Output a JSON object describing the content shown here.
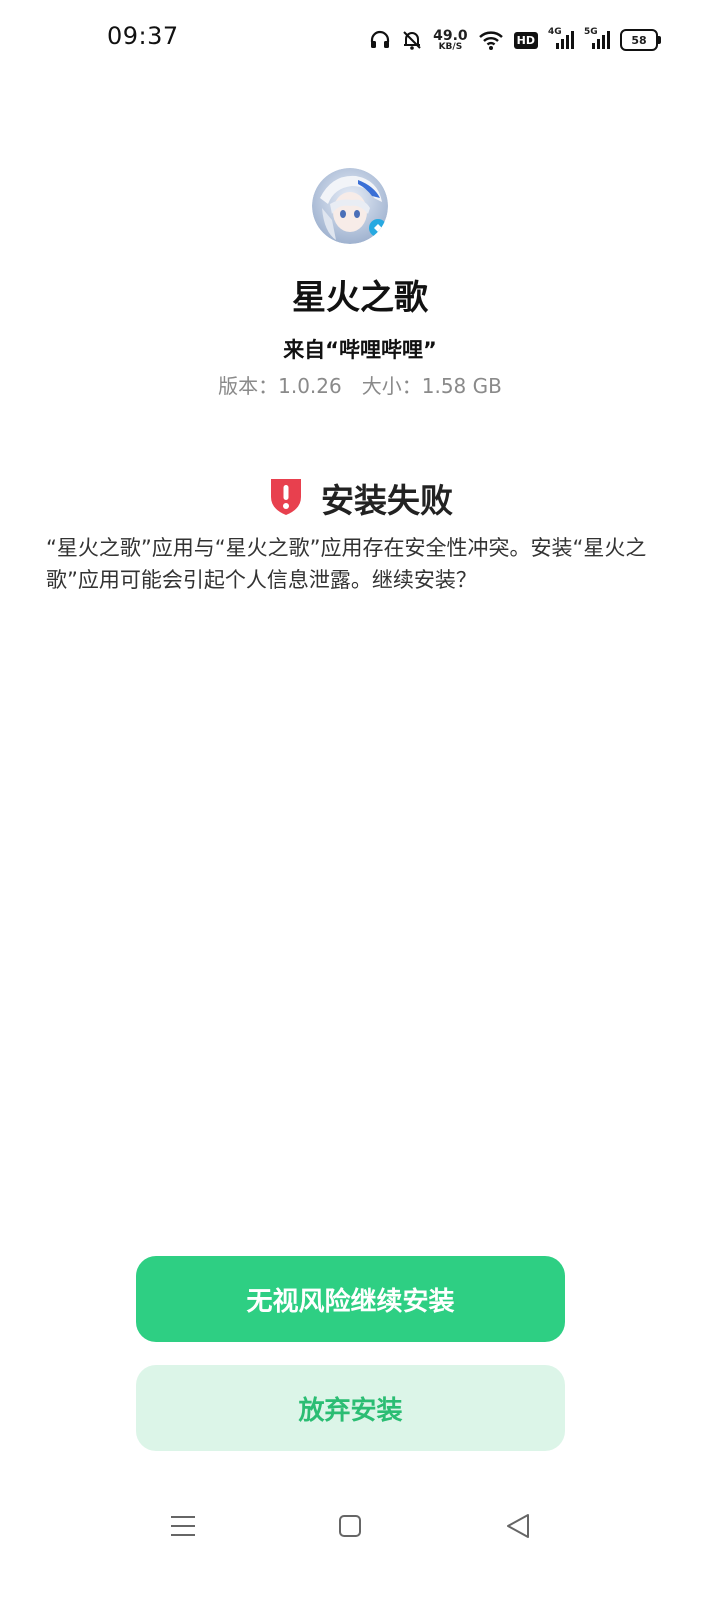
{
  "status_bar": {
    "time": "09:37",
    "net_speed": "49.0",
    "net_speed_unit": "KB/S",
    "hd_badge": "HD",
    "signal1_type": "4G",
    "signal2_type": "5G",
    "battery": "58",
    "icons": [
      "headphones-icon",
      "bell-off-icon",
      "wifi-icon",
      "hd-icon",
      "signal-icon",
      "signal-icon",
      "battery-icon"
    ]
  },
  "app": {
    "name": "星火之歌",
    "source": "来自“哔哩哔哩”",
    "version": "版本：1.0.26",
    "size": "大小：1.58 GB"
  },
  "error": {
    "title": "安装失败",
    "message": "“星火之歌”应用与“星火之歌”应用存在安全性冲突。安装“星火之歌”应用可能会引起个人信息泄露。继续安装？",
    "icon": "shield-alert-icon",
    "icon_color": "#e8404e"
  },
  "buttons": {
    "continue": "无视风险继续安装",
    "cancel": "放弃安装"
  },
  "colors": {
    "primary": "#2ecf83",
    "secondary_bg": "#dcf5e8",
    "secondary_text": "#2bbd73"
  },
  "nav": {
    "icons": [
      "menu-icon",
      "home-icon",
      "back-icon"
    ]
  }
}
